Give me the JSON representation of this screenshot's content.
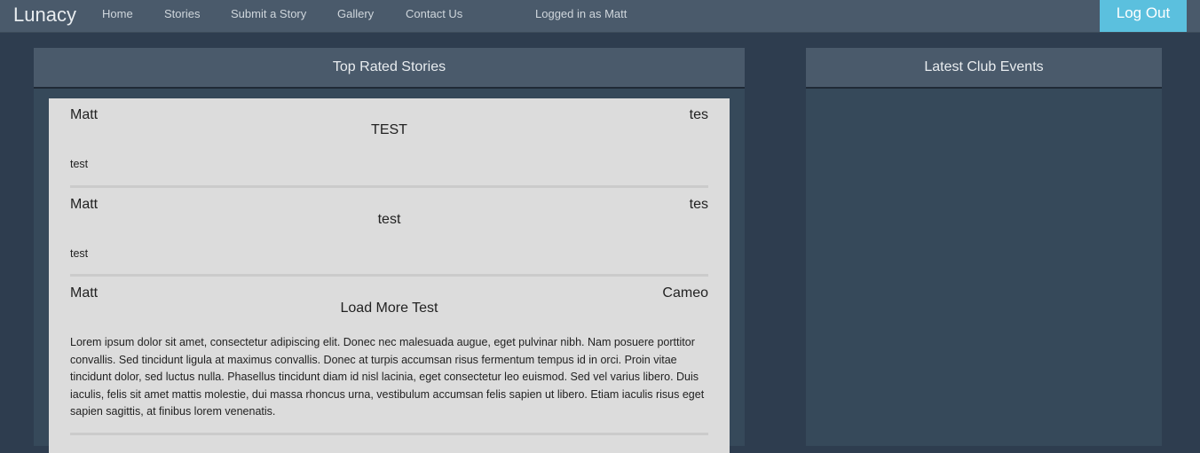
{
  "nav": {
    "brand": "Lunacy",
    "links": [
      "Home",
      "Stories",
      "Submit a Story",
      "Gallery",
      "Contact Us"
    ],
    "logged_in": "Logged in as Matt",
    "logout": "Log Out"
  },
  "top_rated": {
    "title": "Top Rated Stories",
    "stories": [
      {
        "author": "Matt",
        "category": "tes",
        "title": "TEST",
        "body": "test"
      },
      {
        "author": "Matt",
        "category": "tes",
        "title": "test",
        "body": "test"
      },
      {
        "author": "Matt",
        "category": "Cameo",
        "title": "Load More Test",
        "body": "Lorem ipsum dolor sit amet, consectetur adipiscing elit. Donec nec malesuada augue, eget pulvinar nibh. Nam posuere porttitor convallis. Sed tincidunt ligula at maximus convallis. Donec at turpis accumsan risus fermentum tempus id in orci. Proin vitae tincidunt dolor, sed luctus nulla. Phasellus tincidunt diam id nisl lacinia, eget consectetur leo euismod. Sed vel varius libero. Duis iaculis, felis sit amet mattis molestie, dui massa rhoncus urna, vestibulum accumsan felis sapien ut libero. Etiam iaculis risus eget sapien sagittis, at finibus lorem venenatis."
      }
    ]
  },
  "events": {
    "title": "Latest Club Events"
  }
}
